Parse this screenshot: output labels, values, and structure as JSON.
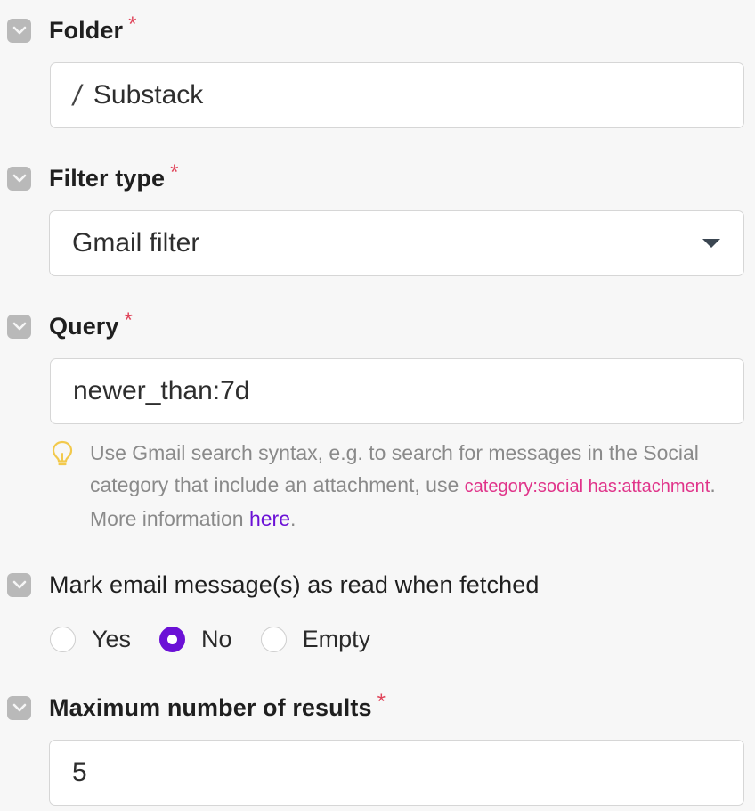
{
  "colors": {
    "background": "#f7f7f7",
    "required_star": "#e0445a",
    "accent": "#6b11d6",
    "code_text": "#e0348a",
    "hint_icon": "#f2c94c"
  },
  "fields": {
    "folder": {
      "label": "Folder",
      "required_mark": "*",
      "prefix_icon": "slash-icon",
      "prefix": "/",
      "value": "Substack"
    },
    "filter_type": {
      "label": "Filter type",
      "required_mark": "*",
      "value": "Gmail filter",
      "dropdown_icon": "caret-down-icon"
    },
    "query": {
      "label": "Query",
      "required_mark": "*",
      "value": "newer_than:7d",
      "hint": {
        "icon": "lightbulb-icon",
        "text_before": "Use Gmail search syntax, e.g. to search for messages in the Social category that include an attachment, use ",
        "code": "category:social has:attachment",
        "text_middle": ". More information ",
        "link_text": "here",
        "text_after": "."
      }
    },
    "mark_read": {
      "label": "Mark email message(s) as read when fetched",
      "options": [
        {
          "label": "Yes",
          "selected": false
        },
        {
          "label": "No",
          "selected": true
        },
        {
          "label": "Empty",
          "selected": false
        }
      ]
    },
    "max_results": {
      "label": "Maximum number of results",
      "required_mark": "*",
      "value": "5"
    }
  }
}
